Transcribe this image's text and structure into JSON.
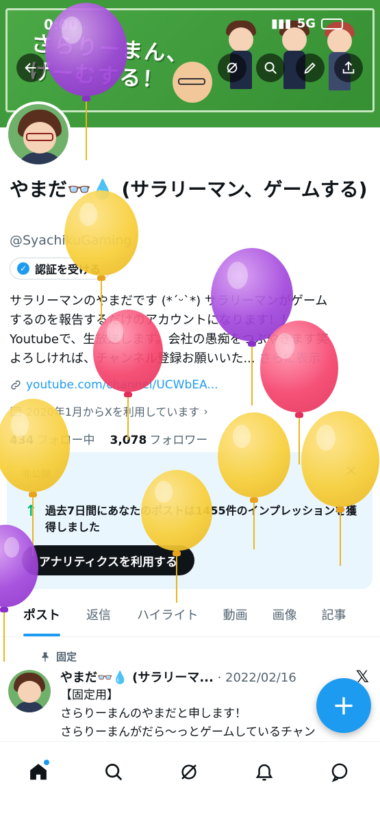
{
  "status": {
    "time": "0:00",
    "network": "5G"
  },
  "banner": {
    "title_line1": "さらりーまん、",
    "title_line2": "げーむする！"
  },
  "profile": {
    "name": "やまだ👓💧 (サラリーマン、ゲームする)",
    "handle": "@SyachikuGaming",
    "verify_label": "認証を受ける",
    "bio_lines": [
      "サラリーマンのやまだです (*´ᵕ`*) サラリーマンがゲーム",
      "するのを報告するだけのアカウントになります！！",
      "Youtubeで、生放送します。会社の愚痴をつぶやきます笑",
      "よろしければ、チャンネル登録お願いいた..."
    ],
    "more_label": "さらに表示",
    "link": "youtube.com/channel/UCWbEA...",
    "joined": "2020年1月からXを利用しています",
    "following_count": "434",
    "following_label": "フォロー中",
    "followers_count": "3,078",
    "followers_label": "フォロワー"
  },
  "analytics_card": {
    "private_label": "非公開",
    "text": "過去7日間にあなたのポストは1455件のインプレッションを獲得しました",
    "button_label": "アナリティクスを利用する"
  },
  "tabs": [
    "ポスト",
    "返信",
    "ハイライト",
    "動画",
    "画像",
    "記事"
  ],
  "pinned_post": {
    "pinned_label": "固定",
    "author": "やまだ👓💧 (サラリーマ...",
    "date": "· 2022/02/16",
    "lines": [
      "【固定用】",
      "さらりーまんのやまだと申します！",
      "さらりーまんがだら～っとゲームしているチャン"
    ]
  },
  "icons": {
    "back": "arrow-left-icon",
    "grok": "grok-icon",
    "search": "search-icon",
    "edit": "edit-icon",
    "share": "share-icon",
    "home": "home-icon",
    "notifications": "bell-icon",
    "messages": "message-icon",
    "compose": "plus-icon"
  },
  "colors": {
    "accent": "#1d9bf0",
    "banner": "#3f9a3b",
    "card": "#eaf6fd"
  }
}
